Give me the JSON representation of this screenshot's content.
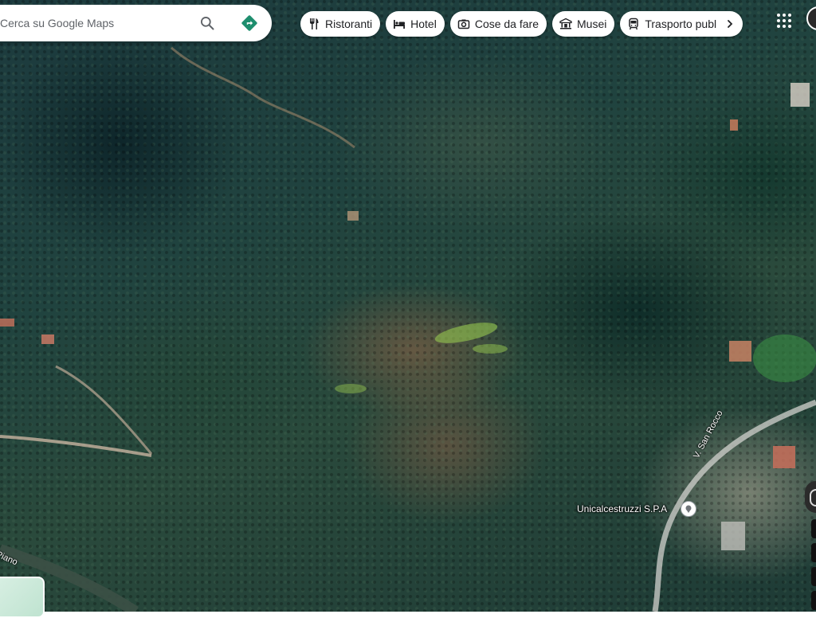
{
  "search": {
    "placeholder": "Cerca su Google Maps",
    "value": ""
  },
  "icons": {
    "search": "search-icon",
    "directions": "directions-icon",
    "apps": "apps-grid-icon",
    "chip_scroll": "chevron-right-icon",
    "place_pin": "place-pin-icon"
  },
  "chips": [
    {
      "label": "Ristoranti",
      "icon": "restaurant-icon"
    },
    {
      "label": "Hotel",
      "icon": "hotel-icon"
    },
    {
      "label": "Cose da fare",
      "icon": "camera-icon"
    },
    {
      "label": "Musei",
      "icon": "museum-icon"
    },
    {
      "label": "Trasporto publ",
      "icon": "transit-icon"
    }
  ],
  "map": {
    "place_label": "Unicalcestruzzi S.P.A",
    "road_label_1": "V. San Rocco",
    "road_label_2": "Piano"
  },
  "colors": {
    "directions": "#1a73e8",
    "directions_bg": "#1e8e6e",
    "chip_text": "#202124",
    "icon_gray": "#5f6368"
  }
}
